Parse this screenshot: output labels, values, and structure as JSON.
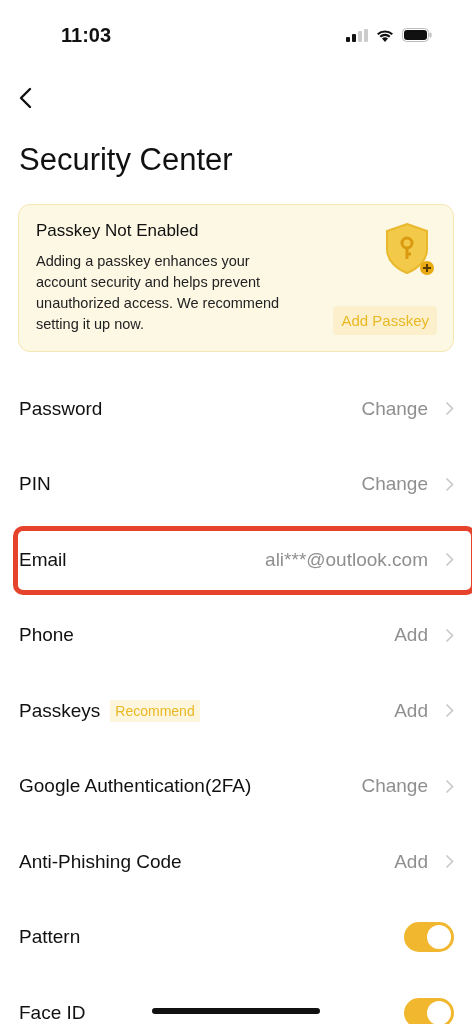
{
  "status_bar": {
    "time": "11:03"
  },
  "title": "Security Center",
  "banner": {
    "title": "Passkey Not Enabled",
    "text": "Adding a passkey enhances your account security and helps prevent unauthorized access. We recommend setting it up now.",
    "button": "Add Passkey"
  },
  "rows": [
    {
      "kind": "link",
      "label": "Password",
      "value": "Change",
      "highlighted": false
    },
    {
      "kind": "link",
      "label": "PIN",
      "value": "Change",
      "highlighted": false
    },
    {
      "kind": "link",
      "label": "Email",
      "value": "ali***@outlook.com",
      "highlighted": true
    },
    {
      "kind": "link",
      "label": "Phone",
      "value": "Add",
      "highlighted": false
    },
    {
      "kind": "link",
      "label": "Passkeys",
      "badge": "Recommend",
      "value": "Add",
      "highlighted": false
    },
    {
      "kind": "link",
      "label": "Google Authentication(2FA)",
      "value": "Change",
      "highlighted": false
    },
    {
      "kind": "link",
      "label": "Anti-Phishing Code",
      "value": "Add",
      "highlighted": false
    },
    {
      "kind": "toggle",
      "label": "Pattern",
      "on": true
    },
    {
      "kind": "toggle",
      "label": "Face ID",
      "on": true
    }
  ]
}
